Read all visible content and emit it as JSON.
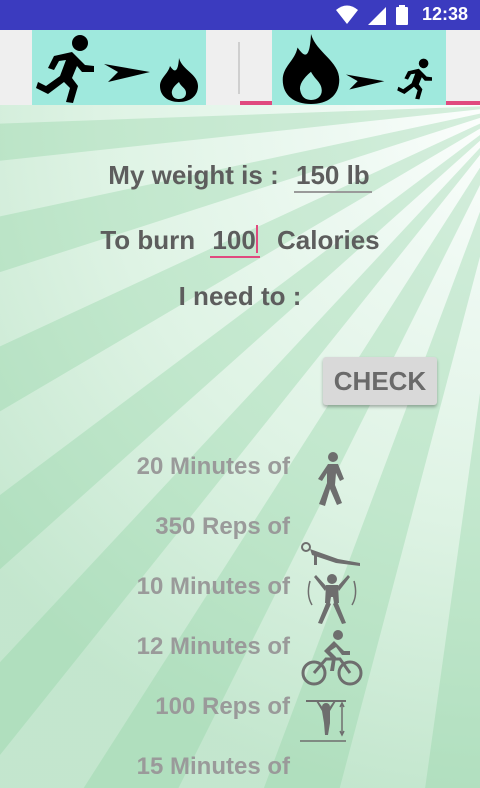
{
  "status_bar": {
    "time": "12:38",
    "icons": [
      "wifi-icon",
      "signal-icon",
      "battery-icon"
    ]
  },
  "tabs": [
    {
      "icons": [
        "runner-icon",
        "arrow-icon",
        "flame-icon"
      ],
      "selected": false
    },
    {
      "icons": [
        "flame-icon",
        "arrow-icon",
        "runner-icon"
      ],
      "selected": false
    }
  ],
  "form": {
    "weight_label": "My weight is :",
    "weight_value": "150 lb",
    "burn_prefix": "To burn",
    "burn_value": "100",
    "burn_suffix": "Calories",
    "need_label": "I need to :",
    "check_label": "CHECK"
  },
  "activities": [
    {
      "text": "20 Minutes  of",
      "icon": "walking-icon"
    },
    {
      "text": "350 Reps  of",
      "icon": "pushup-icon"
    },
    {
      "text": "10 Minutes  of",
      "icon": "jumping-jacks-icon"
    },
    {
      "text": "12 Minutes  of",
      "icon": "cycling-icon"
    },
    {
      "text": "100 Reps  of",
      "icon": "pullup-icon"
    },
    {
      "text": "15 Minutes  of",
      "icon": "partial-icon"
    }
  ],
  "colors": {
    "status_bar": "#3b3bbf",
    "tab_bg": "#9fe9dd",
    "accent": "#e04a7f",
    "text": "#5d5d5d",
    "muted_text": "#9a9a9a"
  }
}
